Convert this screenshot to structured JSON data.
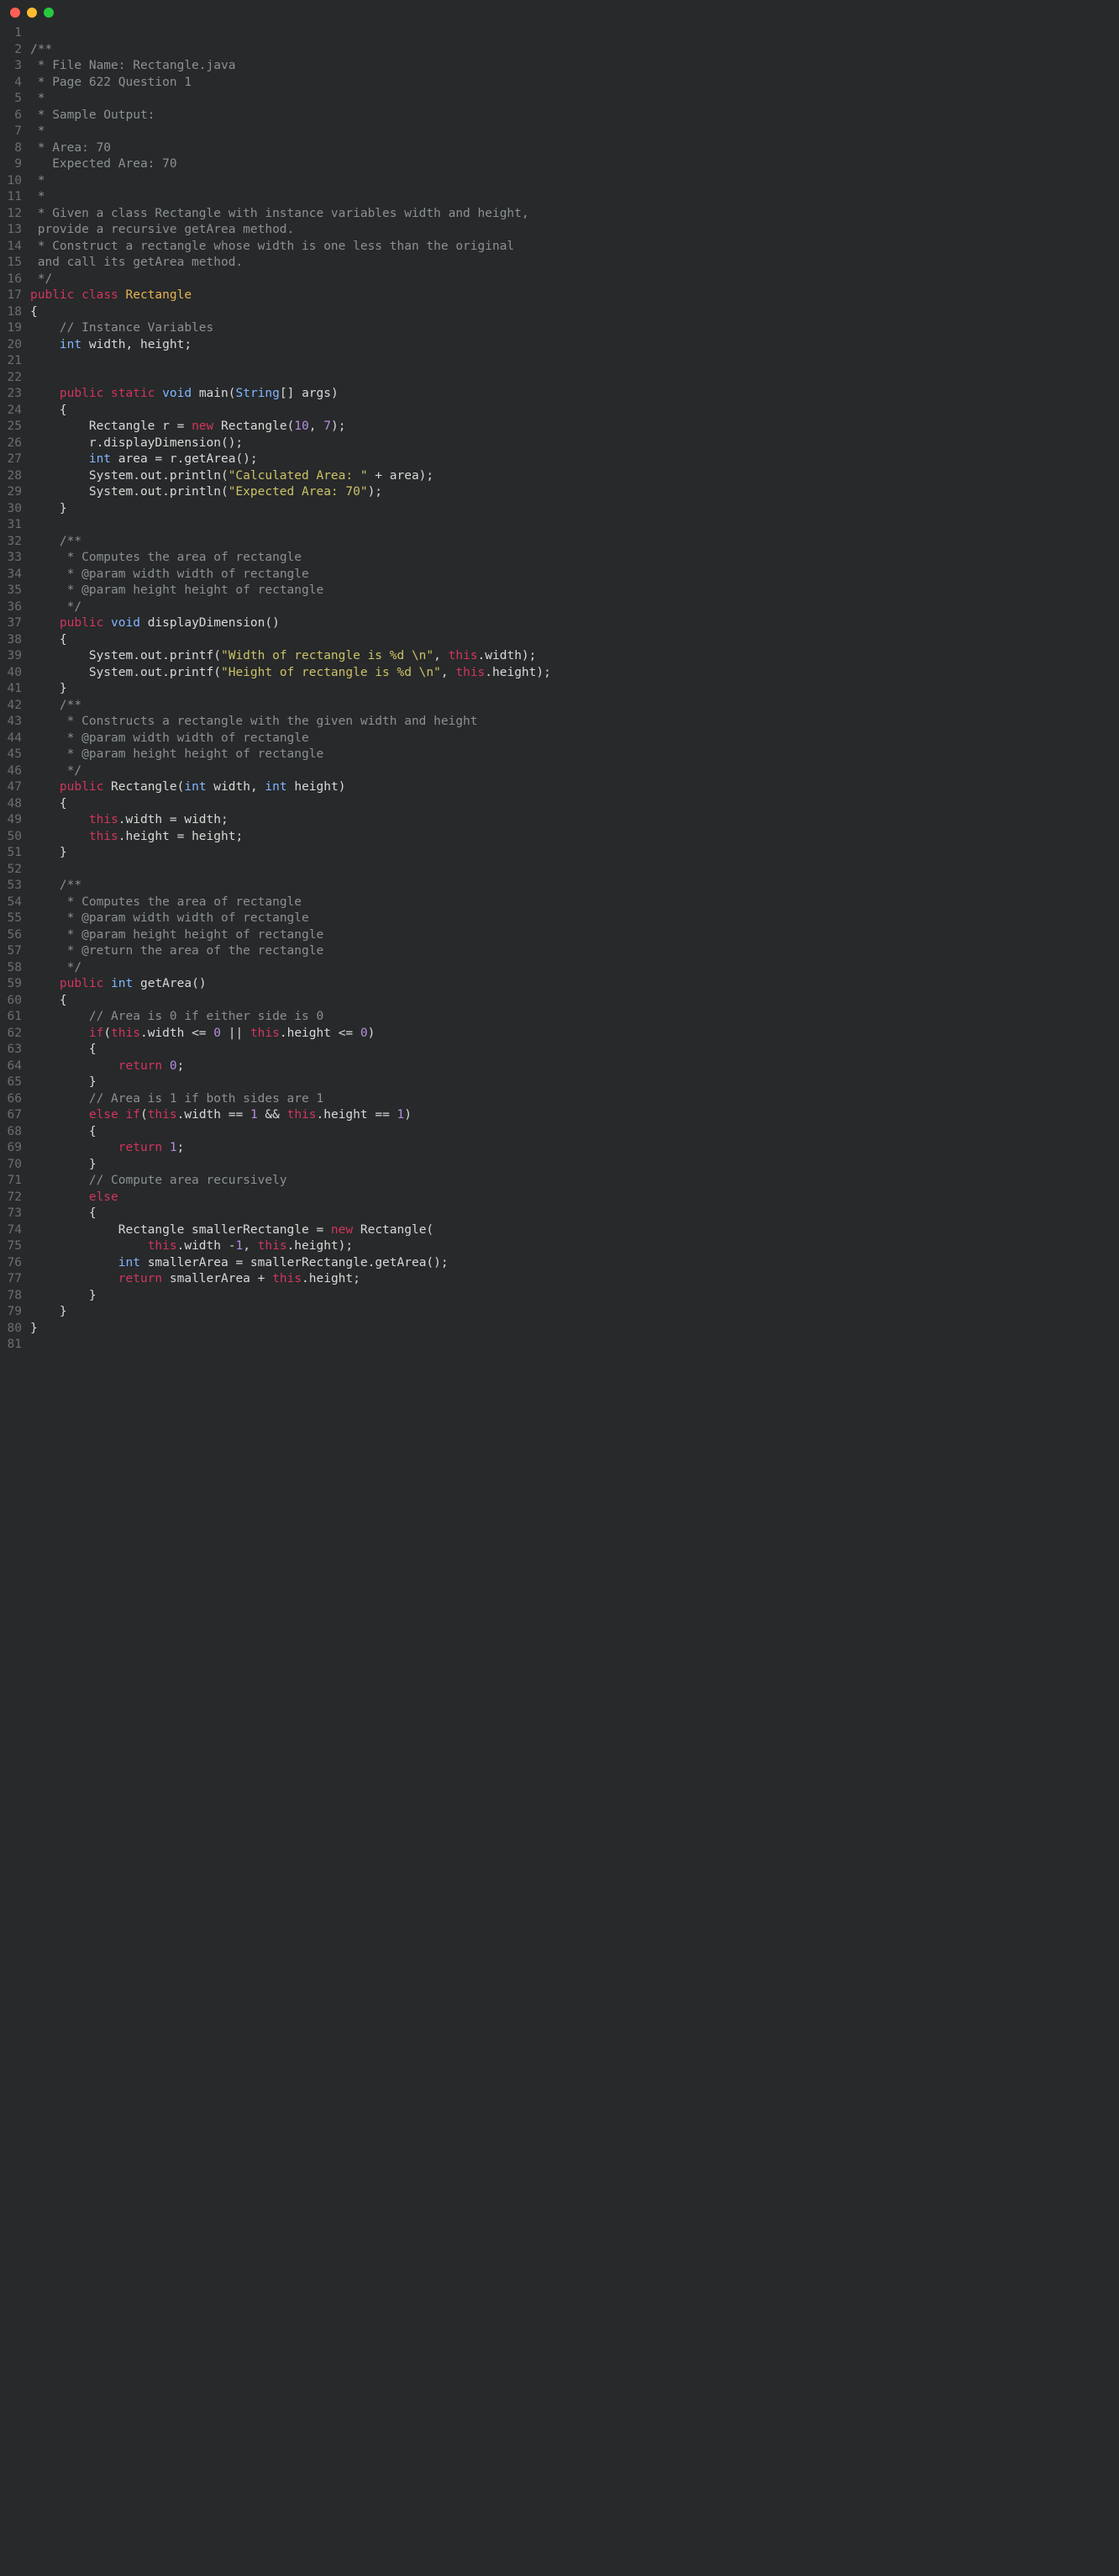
{
  "window": {
    "traffic_lights": [
      "close",
      "minimize",
      "maximize"
    ]
  },
  "code": {
    "lines": 81,
    "tokens": [
      [],
      [
        [
          "comment",
          "/**"
        ]
      ],
      [
        [
          "comment",
          " * File Name: Rectangle.java"
        ]
      ],
      [
        [
          "comment",
          " * Page 622 Question 1"
        ]
      ],
      [
        [
          "comment",
          " *"
        ]
      ],
      [
        [
          "comment",
          " * Sample Output:"
        ]
      ],
      [
        [
          "comment",
          " *"
        ]
      ],
      [
        [
          "comment",
          " * Area: 70"
        ]
      ],
      [
        [
          "comment",
          "   Expected Area: 70"
        ]
      ],
      [
        [
          "comment",
          " *"
        ]
      ],
      [
        [
          "comment",
          " *"
        ]
      ],
      [
        [
          "comment",
          " * Given a class Rectangle with instance variables width and height,"
        ]
      ],
      [
        [
          "comment",
          " provide a recursive getArea method."
        ]
      ],
      [
        [
          "comment",
          " * Construct a rectangle whose width is one less than the original"
        ]
      ],
      [
        [
          "comment",
          " and call its getArea method."
        ]
      ],
      [
        [
          "comment",
          " */"
        ]
      ],
      [
        [
          "keyword",
          "public"
        ],
        [
          "default",
          " "
        ],
        [
          "keyword",
          "class"
        ],
        [
          "default",
          " "
        ],
        [
          "class",
          "Rectangle"
        ]
      ],
      [
        [
          "default",
          "{"
        ]
      ],
      [
        [
          "default",
          "    "
        ],
        [
          "comment",
          "// Instance Variables"
        ]
      ],
      [
        [
          "default",
          "    "
        ],
        [
          "type",
          "int"
        ],
        [
          "default",
          " width, height;"
        ]
      ],
      [],
      [],
      [
        [
          "default",
          "    "
        ],
        [
          "keyword",
          "public"
        ],
        [
          "default",
          " "
        ],
        [
          "keyword",
          "static"
        ],
        [
          "default",
          " "
        ],
        [
          "type",
          "void"
        ],
        [
          "default",
          " "
        ],
        [
          "func",
          "main"
        ],
        [
          "default",
          "("
        ],
        [
          "type",
          "String"
        ],
        [
          "default",
          "[] args)"
        ]
      ],
      [
        [
          "default",
          "    {"
        ]
      ],
      [
        [
          "default",
          "        Rectangle r = "
        ],
        [
          "keyword",
          "new"
        ],
        [
          "default",
          " Rectangle("
        ],
        [
          "number",
          "10"
        ],
        [
          "default",
          ", "
        ],
        [
          "number",
          "7"
        ],
        [
          "default",
          ");"
        ]
      ],
      [
        [
          "default",
          "        r.displayDimension();"
        ]
      ],
      [
        [
          "default",
          "        "
        ],
        [
          "type",
          "int"
        ],
        [
          "default",
          " area = r.getArea();"
        ]
      ],
      [
        [
          "default",
          "        System.out.println("
        ],
        [
          "string",
          "\"Calculated Area: \""
        ],
        [
          "default",
          " + area);"
        ]
      ],
      [
        [
          "default",
          "        System.out.println("
        ],
        [
          "string",
          "\"Expected Area: 70\""
        ],
        [
          "default",
          ");"
        ]
      ],
      [
        [
          "default",
          "    }"
        ]
      ],
      [],
      [
        [
          "default",
          "    "
        ],
        [
          "comment",
          "/**"
        ]
      ],
      [
        [
          "default",
          "    "
        ],
        [
          "comment",
          " * Computes the area of rectangle"
        ]
      ],
      [
        [
          "default",
          "    "
        ],
        [
          "comment",
          " * @param width width of rectangle"
        ]
      ],
      [
        [
          "default",
          "    "
        ],
        [
          "comment",
          " * @param height height of rectangle"
        ]
      ],
      [
        [
          "default",
          "    "
        ],
        [
          "comment",
          " */"
        ]
      ],
      [
        [
          "default",
          "    "
        ],
        [
          "keyword",
          "public"
        ],
        [
          "default",
          " "
        ],
        [
          "type",
          "void"
        ],
        [
          "default",
          " "
        ],
        [
          "func",
          "displayDimension"
        ],
        [
          "default",
          "()"
        ]
      ],
      [
        [
          "default",
          "    {"
        ]
      ],
      [
        [
          "default",
          "        System.out.printf("
        ],
        [
          "string",
          "\"Width of rectangle is %d \\n\""
        ],
        [
          "default",
          ", "
        ],
        [
          "this",
          "this"
        ],
        [
          "default",
          ".width);"
        ]
      ],
      [
        [
          "default",
          "        System.out.printf("
        ],
        [
          "string",
          "\"Height of rectangle is %d \\n\""
        ],
        [
          "default",
          ", "
        ],
        [
          "this",
          "this"
        ],
        [
          "default",
          ".height);"
        ]
      ],
      [
        [
          "default",
          "    }"
        ]
      ],
      [
        [
          "default",
          "    "
        ],
        [
          "comment",
          "/**"
        ]
      ],
      [
        [
          "default",
          "    "
        ],
        [
          "comment",
          " * Constructs a rectangle with the given width and height"
        ]
      ],
      [
        [
          "default",
          "    "
        ],
        [
          "comment",
          " * @param width width of rectangle"
        ]
      ],
      [
        [
          "default",
          "    "
        ],
        [
          "comment",
          " * @param height height of rectangle"
        ]
      ],
      [
        [
          "default",
          "    "
        ],
        [
          "comment",
          " */"
        ]
      ],
      [
        [
          "default",
          "    "
        ],
        [
          "keyword",
          "public"
        ],
        [
          "default",
          " "
        ],
        [
          "func",
          "Rectangle"
        ],
        [
          "default",
          "("
        ],
        [
          "type",
          "int"
        ],
        [
          "default",
          " width, "
        ],
        [
          "type",
          "int"
        ],
        [
          "default",
          " height)"
        ]
      ],
      [
        [
          "default",
          "    {"
        ]
      ],
      [
        [
          "default",
          "        "
        ],
        [
          "this",
          "this"
        ],
        [
          "default",
          ".width = width;"
        ]
      ],
      [
        [
          "default",
          "        "
        ],
        [
          "this",
          "this"
        ],
        [
          "default",
          ".height = height;"
        ]
      ],
      [
        [
          "default",
          "    }"
        ]
      ],
      [],
      [
        [
          "default",
          "    "
        ],
        [
          "comment",
          "/**"
        ]
      ],
      [
        [
          "default",
          "    "
        ],
        [
          "comment",
          " * Computes the area of rectangle"
        ]
      ],
      [
        [
          "default",
          "    "
        ],
        [
          "comment",
          " * @param width width of rectangle"
        ]
      ],
      [
        [
          "default",
          "    "
        ],
        [
          "comment",
          " * @param height height of rectangle"
        ]
      ],
      [
        [
          "default",
          "    "
        ],
        [
          "comment",
          " * @return the area of the rectangle"
        ]
      ],
      [
        [
          "default",
          "    "
        ],
        [
          "comment",
          " */"
        ]
      ],
      [
        [
          "default",
          "    "
        ],
        [
          "keyword",
          "public"
        ],
        [
          "default",
          " "
        ],
        [
          "type",
          "int"
        ],
        [
          "default",
          " "
        ],
        [
          "func",
          "getArea"
        ],
        [
          "default",
          "()"
        ]
      ],
      [
        [
          "default",
          "    {"
        ]
      ],
      [
        [
          "default",
          "        "
        ],
        [
          "comment",
          "// Area is 0 if either side is 0"
        ]
      ],
      [
        [
          "default",
          "        "
        ],
        [
          "keyword",
          "if"
        ],
        [
          "default",
          "("
        ],
        [
          "this",
          "this"
        ],
        [
          "default",
          ".width <= "
        ],
        [
          "number",
          "0"
        ],
        [
          "default",
          " || "
        ],
        [
          "this",
          "this"
        ],
        [
          "default",
          ".height <= "
        ],
        [
          "number",
          "0"
        ],
        [
          "default",
          ")"
        ]
      ],
      [
        [
          "default",
          "        {"
        ]
      ],
      [
        [
          "default",
          "            "
        ],
        [
          "keyword",
          "return"
        ],
        [
          "default",
          " "
        ],
        [
          "number",
          "0"
        ],
        [
          "default",
          ";"
        ]
      ],
      [
        [
          "default",
          "        }"
        ]
      ],
      [
        [
          "default",
          "        "
        ],
        [
          "comment",
          "// Area is 1 if both sides are 1"
        ]
      ],
      [
        [
          "default",
          "        "
        ],
        [
          "keyword",
          "else"
        ],
        [
          "default",
          " "
        ],
        [
          "keyword",
          "if"
        ],
        [
          "default",
          "("
        ],
        [
          "this",
          "this"
        ],
        [
          "default",
          ".width == "
        ],
        [
          "number",
          "1"
        ],
        [
          "default",
          " && "
        ],
        [
          "this",
          "this"
        ],
        [
          "default",
          ".height == "
        ],
        [
          "number",
          "1"
        ],
        [
          "default",
          ")"
        ]
      ],
      [
        [
          "default",
          "        {"
        ]
      ],
      [
        [
          "default",
          "            "
        ],
        [
          "keyword",
          "return"
        ],
        [
          "default",
          " "
        ],
        [
          "number",
          "1"
        ],
        [
          "default",
          ";"
        ]
      ],
      [
        [
          "default",
          "        }"
        ]
      ],
      [
        [
          "default",
          "        "
        ],
        [
          "comment",
          "// Compute area recursively"
        ]
      ],
      [
        [
          "default",
          "        "
        ],
        [
          "keyword",
          "else"
        ]
      ],
      [
        [
          "default",
          "        {"
        ]
      ],
      [
        [
          "default",
          "            Rectangle smallerRectangle = "
        ],
        [
          "keyword",
          "new"
        ],
        [
          "default",
          " Rectangle("
        ]
      ],
      [
        [
          "default",
          "                "
        ],
        [
          "this",
          "this"
        ],
        [
          "default",
          ".width -"
        ],
        [
          "number",
          "1"
        ],
        [
          "default",
          ", "
        ],
        [
          "this",
          "this"
        ],
        [
          "default",
          ".height);"
        ]
      ],
      [
        [
          "default",
          "            "
        ],
        [
          "type",
          "int"
        ],
        [
          "default",
          " smallerArea = smallerRectangle.getArea();"
        ]
      ],
      [
        [
          "default",
          "            "
        ],
        [
          "keyword",
          "return"
        ],
        [
          "default",
          " smallerArea + "
        ],
        [
          "this",
          "this"
        ],
        [
          "default",
          ".height;"
        ]
      ],
      [
        [
          "default",
          "        }"
        ]
      ],
      [
        [
          "default",
          "    }"
        ]
      ],
      [
        [
          "default",
          "}"
        ]
      ],
      []
    ]
  }
}
